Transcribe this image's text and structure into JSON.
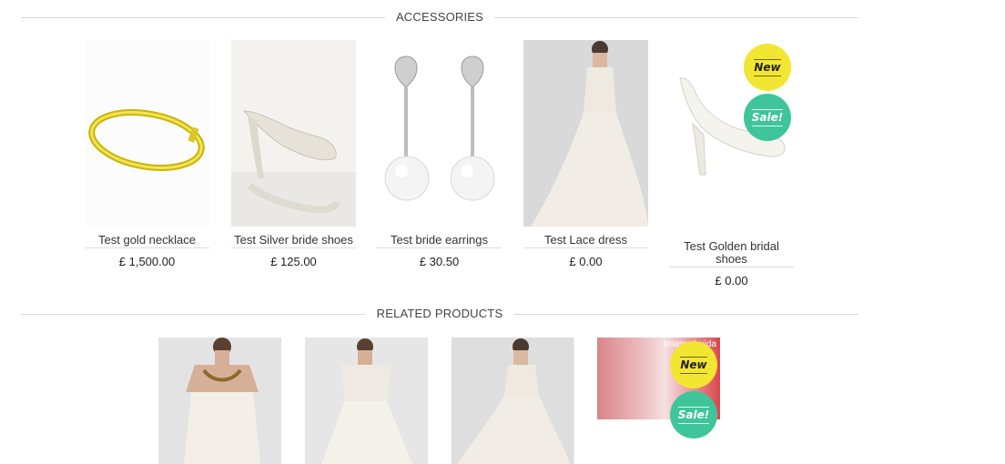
{
  "accessories": {
    "heading": "ACCESSORIES",
    "products": [
      {
        "name": "Test gold necklace",
        "price": "£ 1,500.00"
      },
      {
        "name": "Test Silver bride shoes",
        "price": "£ 125.00"
      },
      {
        "name": "Test bride earrings",
        "price": "£ 30.50"
      },
      {
        "name": "Test Lace dress",
        "price": "£ 0.00"
      },
      {
        "name": "Test Golden bridal shoes",
        "price": "£ 0.00",
        "badges": [
          "New",
          "Sale!"
        ]
      }
    ]
  },
  "related": {
    "heading": "RELATED PRODUCTS",
    "placeholder_text": "Imatge buida",
    "badges": [
      "New",
      "Sale!"
    ]
  },
  "colors": {
    "badge_new": "#f2e632",
    "badge_sale": "#3ec59a",
    "divider": "#d9d9d9"
  }
}
